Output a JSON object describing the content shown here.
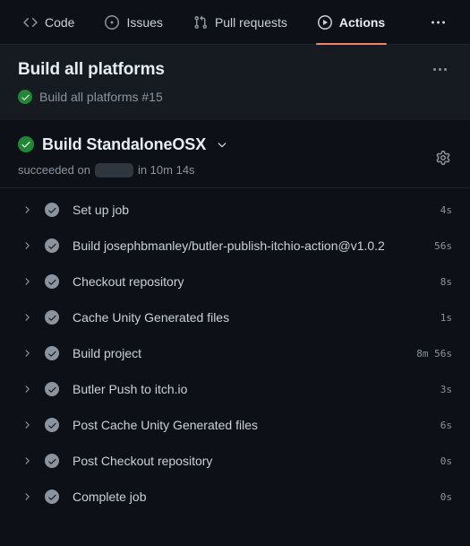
{
  "nav": {
    "tabs": [
      {
        "label": "Code",
        "icon": "code-icon",
        "active": false
      },
      {
        "label": "Issues",
        "icon": "issue-opened-icon",
        "active": false
      },
      {
        "label": "Pull requests",
        "icon": "git-pull-request-icon",
        "active": false
      },
      {
        "label": "Actions",
        "icon": "play-circle-icon",
        "active": true
      }
    ],
    "overflow_icon": "kebab-horizontal-icon"
  },
  "run": {
    "title": "Build all platforms",
    "subtitle": "Build all platforms #15",
    "status_icon": "check-circle-fill-icon",
    "overflow_icon": "kebab-horizontal-icon"
  },
  "job": {
    "name": "Build StandaloneOSX",
    "status_icon": "check-circle-fill-icon",
    "chevron_icon": "chevron-down-icon",
    "settings_icon": "gear-icon",
    "status_prefix": "succeeded on",
    "status_date_redacted": "",
    "status_suffix": "in 10m 14s"
  },
  "steps": [
    {
      "name": "Set up job",
      "duration": "4s",
      "status_icon": "check-circle-fill-icon",
      "chevron_icon": "chevron-right-icon"
    },
    {
      "name": "Build josephbmanley/butler-publish-itchio-action@v1.0.2",
      "duration": "56s",
      "status_icon": "check-circle-fill-icon",
      "chevron_icon": "chevron-right-icon"
    },
    {
      "name": "Checkout repository",
      "duration": "8s",
      "status_icon": "check-circle-fill-icon",
      "chevron_icon": "chevron-right-icon"
    },
    {
      "name": "Cache Unity Generated files",
      "duration": "1s",
      "status_icon": "check-circle-fill-icon",
      "chevron_icon": "chevron-right-icon"
    },
    {
      "name": "Build project",
      "duration": "8m 56s",
      "status_icon": "check-circle-fill-icon",
      "chevron_icon": "chevron-right-icon"
    },
    {
      "name": "Butler Push to itch.io",
      "duration": "3s",
      "status_icon": "check-circle-fill-icon",
      "chevron_icon": "chevron-right-icon"
    },
    {
      "name": "Post Cache Unity Generated files",
      "duration": "6s",
      "status_icon": "check-circle-fill-icon",
      "chevron_icon": "chevron-right-icon"
    },
    {
      "name": "Post Checkout repository",
      "duration": "0s",
      "status_icon": "check-circle-fill-icon",
      "chevron_icon": "chevron-right-icon"
    },
    {
      "name": "Complete job",
      "duration": "0s",
      "status_icon": "check-circle-fill-icon",
      "chevron_icon": "chevron-right-icon"
    }
  ],
  "colors": {
    "background": "#0d1117",
    "surface": "#161b22",
    "border": "#21262d",
    "text_primary": "#e6edf3",
    "text_secondary": "#c9d1d9",
    "text_muted": "#8b949e",
    "success": "#238636",
    "active_underline": "#f78166",
    "redacted": "#30363d"
  }
}
